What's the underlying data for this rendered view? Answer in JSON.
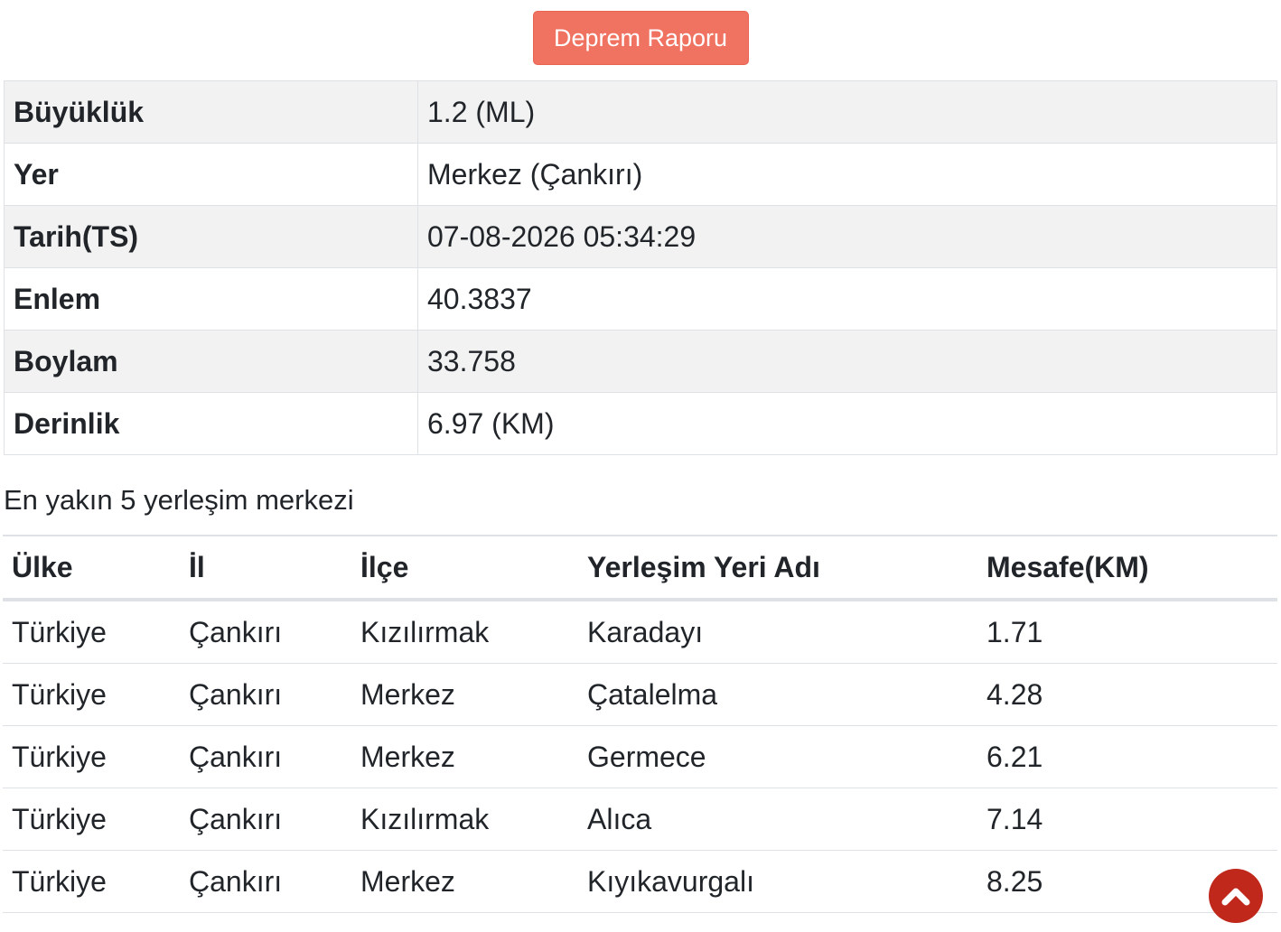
{
  "report_button": {
    "label": "Deprem Raporu"
  },
  "details": [
    {
      "key": "Büyüklük",
      "value": "1.2 (ML)"
    },
    {
      "key": "Yer",
      "value": "Merkez (Çankırı)"
    },
    {
      "key": "Tarih(TS)",
      "value": "07-08-2026 05:34:29"
    },
    {
      "key": "Enlem",
      "value": "40.3837"
    },
    {
      "key": "Boylam",
      "value": "33.758"
    },
    {
      "key": "Derinlik",
      "value": "6.97 (KM)"
    }
  ],
  "nearest": {
    "title": "En yakın 5 yerleşim merkezi",
    "headers": [
      "Ülke",
      "İl",
      "İlçe",
      "Yerleşim Yeri Adı",
      "Mesafe(KM)"
    ],
    "rows": [
      [
        "Türkiye",
        "Çankırı",
        "Kızılırmak",
        "Karadayı",
        "1.71"
      ],
      [
        "Türkiye",
        "Çankırı",
        "Merkez",
        "Çatalelma",
        "4.28"
      ],
      [
        "Türkiye",
        "Çankırı",
        "Merkez",
        "Germece",
        "6.21"
      ],
      [
        "Türkiye",
        "Çankırı",
        "Kızılırmak",
        "Alıca",
        "7.14"
      ],
      [
        "Türkiye",
        "Çankırı",
        "Merkez",
        "Kıyıkavurgalı",
        "8.25"
      ]
    ]
  },
  "scroll_top": {
    "icon": "chevron-up-icon",
    "color": "#c0281c"
  },
  "colors": {
    "button": "#f07261",
    "stripe": "#f2f2f2",
    "border": "#dee2e6"
  }
}
